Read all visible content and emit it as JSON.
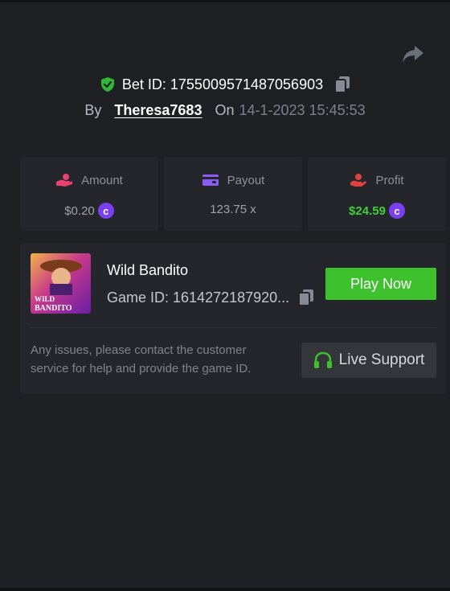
{
  "bet": {
    "id_label": "Bet ID: 1755009571487056903",
    "by_label": "By",
    "username": "Theresa7683",
    "on_label": "On",
    "datetime": "14-1-2023 15:45:53"
  },
  "stats": {
    "amount": {
      "label": "Amount",
      "value": "$0.20",
      "icon": "hand-coin-icon",
      "color": "#e8416e"
    },
    "payout": {
      "label": "Payout",
      "value": "123.75 x",
      "icon": "wallet-icon",
      "color": "#8a5cf6"
    },
    "profit": {
      "label": "Profit",
      "value": "$24.59",
      "icon": "profit-hand-icon",
      "color": "#e04242"
    }
  },
  "currency_symbol": "c",
  "game": {
    "name": "Wild Bandito",
    "id_label": "Game ID: 1614272187920...",
    "play_label": "Play Now",
    "thumb_title_line1": "WILD",
    "thumb_title_line2": "BANDITO"
  },
  "support": {
    "text": "Any issues, please contact the customer service for help and provide the game ID.",
    "button_label": "Live Support"
  },
  "colors": {
    "background": "#1f2024",
    "card": "#25262b",
    "accent_green": "#3dc22e",
    "coin_purple": "#7b3ff2"
  }
}
